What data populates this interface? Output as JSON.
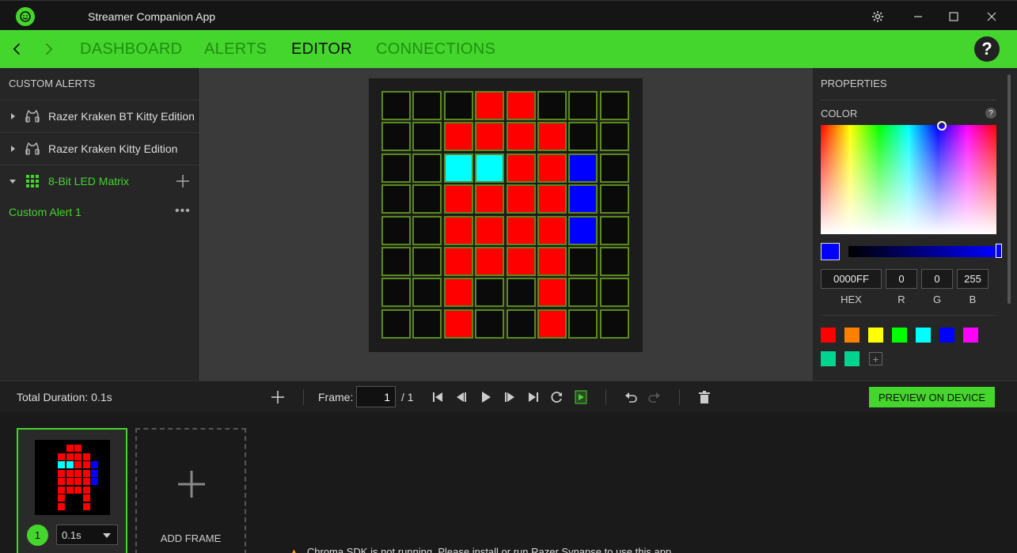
{
  "window": {
    "title": "Streamer Companion App"
  },
  "nav": {
    "tabs": [
      "DASHBOARD",
      "ALERTS",
      "EDITOR",
      "CONNECTIONS"
    ],
    "active_tab": "EDITOR",
    "help_label": "?"
  },
  "sidebar": {
    "header": "CUSTOM ALERTS",
    "devices": [
      {
        "label": "Razer Kraken BT Kitty Edition",
        "icon": "kitty-headset-icon",
        "expanded": false
      },
      {
        "label": "Razer Kraken Kitty Edition",
        "icon": "kitty-headset-icon",
        "expanded": false
      },
      {
        "label": "8-Bit LED Matrix",
        "icon": "led-matrix-icon",
        "expanded": true
      }
    ],
    "alerts": [
      "Custom Alert 1"
    ],
    "more_label": "•••"
  },
  "matrix": {
    "rows": 8,
    "cols": 8,
    "colors": {
      "K": "#0a0a0a",
      "R": "#ff0000",
      "C": "#00ffff",
      "B": "#0000ff"
    },
    "grid": [
      "KKKRRKKK",
      "KKRRRRKK",
      "KKCCRRBK",
      "KKRRRRBK",
      "KKRRRRBK",
      "KKRRRRKK",
      "KKRKKRKK",
      "KKRKKRKK"
    ]
  },
  "properties": {
    "title": "PROPERTIES",
    "color_title": "COLOR",
    "help_label": "?",
    "hex": "0000FF",
    "r": "0",
    "g": "0",
    "b": "255",
    "hex_label": "HEX",
    "r_label": "R",
    "g_label": "G",
    "b_label": "B",
    "current_color": "#0000ff",
    "swatches": [
      "#ff0000",
      "#ff8000",
      "#ffff00",
      "#00ff00",
      "#00ffff",
      "#0000ff",
      "#ff00ff",
      "#00d48f",
      "#00d48f"
    ],
    "add_swatch_label": "+"
  },
  "toolbar": {
    "total_duration": "Total Duration: 0.1s",
    "frame_label": "Frame:",
    "frame_value": "1",
    "frame_total": "/ 1",
    "preview_label": "PREVIEW ON DEVICE"
  },
  "timeline": {
    "frames": [
      {
        "number": "1",
        "duration": "0.1s"
      }
    ],
    "add_frame_label": "ADD FRAME"
  },
  "notice": {
    "text": "Chroma SDK is not running. Please install or run Razer Synapse to use this app."
  },
  "accent_color": "#44d62c"
}
